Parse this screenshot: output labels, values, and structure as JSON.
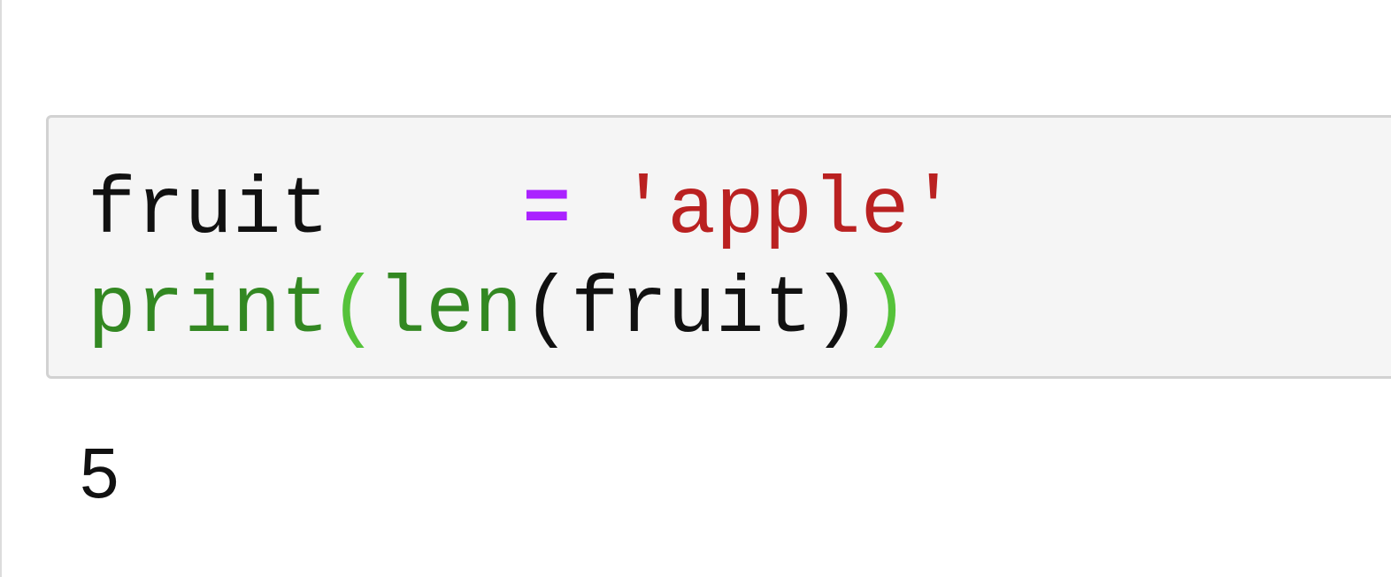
{
  "cell": {
    "line1": {
      "name": "fruit",
      "spacing": "   ",
      "operator": "=",
      "string": "'apple'"
    },
    "line2": {
      "print": "print",
      "open_outer": "(",
      "len": "len",
      "open_inner": "(",
      "arg": "fruit",
      "close_inner": ")",
      "close_outer": ")"
    }
  },
  "output": {
    "text": "5"
  },
  "colors": {
    "cell_background": "#f5f5f5",
    "cell_border": "#d2d2d2",
    "operator": "#aa22ff",
    "string": "#ba2121",
    "builtin": "#338822"
  }
}
